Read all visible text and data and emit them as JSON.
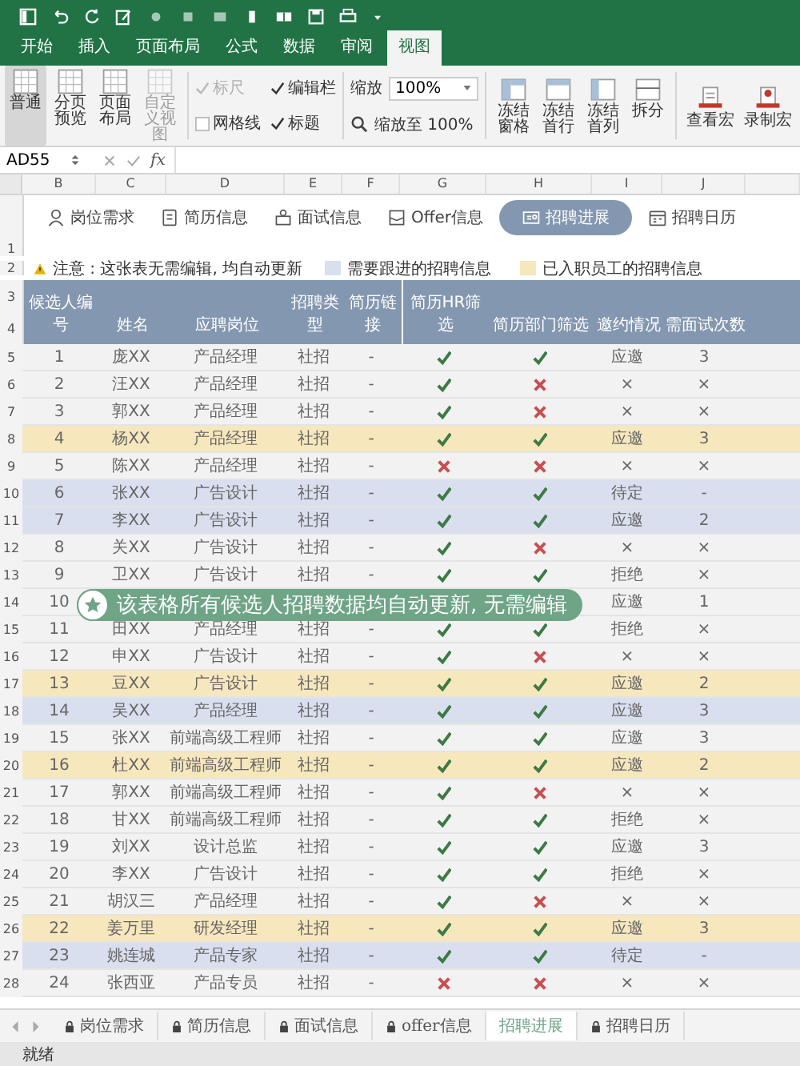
{
  "ribbon_tabs": [
    {
      "label": "开始",
      "selected": false
    },
    {
      "label": "插入",
      "selected": false
    },
    {
      "label": "页面布局",
      "selected": false
    },
    {
      "label": "公式",
      "selected": false
    },
    {
      "label": "数据",
      "selected": false
    },
    {
      "label": "审阅",
      "selected": false
    },
    {
      "label": "视图",
      "selected": true
    }
  ],
  "view_buttons": [
    {
      "label": "普通",
      "selected": true,
      "disabled": false
    },
    {
      "label": "分页预览",
      "selected": false,
      "disabled": false
    },
    {
      "label": "页面布局",
      "selected": false,
      "disabled": false
    },
    {
      "label": "自定义视图",
      "selected": false,
      "disabled": true
    }
  ],
  "show_options": [
    {
      "label": "标尺",
      "checked": true,
      "disabled": true
    },
    {
      "label": "编辑栏",
      "checked": true,
      "disabled": false
    },
    {
      "label": "网格线",
      "checked": false,
      "disabled": false
    },
    {
      "label": "标题",
      "checked": true,
      "disabled": false
    }
  ],
  "zoom": {
    "label": "缩放",
    "value": "100%",
    "zoom_to": "缩放至 100%"
  },
  "window_buttons": [
    {
      "label": "冻结窗格",
      "kind": "freeze"
    },
    {
      "label": "冻结首行",
      "kind": "freeze-row"
    },
    {
      "label": "冻结首列",
      "kind": "freeze-col"
    },
    {
      "label": "拆分",
      "kind": "split"
    }
  ],
  "macro_buttons": [
    {
      "label": "查看宏",
      "kind": "view"
    },
    {
      "label": "录制宏",
      "kind": "record"
    }
  ],
  "formula_bar": {
    "cell": "AD55",
    "fx": "fx"
  },
  "column_letters": [
    "B",
    "C",
    "D",
    "E",
    "F",
    "G",
    "H",
    "I",
    "J"
  ],
  "nav_buttons": [
    {
      "label": "岗位需求",
      "kind": "person",
      "selected": false
    },
    {
      "label": "简历信息",
      "kind": "doc",
      "selected": false
    },
    {
      "label": "面试信息",
      "kind": "people",
      "selected": false
    },
    {
      "label": "Offer信息",
      "kind": "mail",
      "selected": false
    },
    {
      "label": "招聘进展",
      "kind": "card",
      "selected": true
    },
    {
      "label": "招聘日历",
      "kind": "calendar",
      "selected": false
    }
  ],
  "header_row_numbers": [
    "1",
    "2",
    "3",
    "4"
  ],
  "notice": "注意 : 这张表无需编辑, 均自动更新",
  "legend": [
    {
      "label": "需要跟进的招聘信息",
      "color": "#d9dfee"
    },
    {
      "label": "已入职员工的招聘信息",
      "color": "#f7e7bd"
    }
  ],
  "columns": [
    "候选人编号",
    "姓名",
    "应聘岗位",
    "招聘类型",
    "简历链接",
    "简历HR筛选",
    "简历部门筛选",
    "邀约情况",
    "需面试次数"
  ],
  "rows": [
    {
      "row_number": "5",
      "id": "1",
      "name": "庞XX",
      "position": "产品经理",
      "type": "社招",
      "link": "-",
      "hr_pass": true,
      "dept_pass": true,
      "invite": "应邀",
      "interviews": "3",
      "color": "#f2f2f2"
    },
    {
      "row_number": "6",
      "id": "2",
      "name": "汪XX",
      "position": "产品经理",
      "type": "社招",
      "link": "-",
      "hr_pass": true,
      "dept_pass": false,
      "invite": "×",
      "interviews": "×",
      "color": "#f2f2f2"
    },
    {
      "row_number": "7",
      "id": "3",
      "name": "郭XX",
      "position": "产品经理",
      "type": "社招",
      "link": "-",
      "hr_pass": true,
      "dept_pass": false,
      "invite": "×",
      "interviews": "×",
      "color": "#f2f2f2"
    },
    {
      "row_number": "8",
      "id": "4",
      "name": "杨XX",
      "position": "产品经理",
      "type": "社招",
      "link": "-",
      "hr_pass": true,
      "dept_pass": true,
      "invite": "应邀",
      "interviews": "3",
      "color": "#f7e7bd"
    },
    {
      "row_number": "9",
      "id": "5",
      "name": "陈XX",
      "position": "产品经理",
      "type": "社招",
      "link": "-",
      "hr_pass": false,
      "dept_pass": false,
      "invite": "×",
      "interviews": "×",
      "color": "#f2f2f2"
    },
    {
      "row_number": "10",
      "id": "6",
      "name": "张XX",
      "position": "广告设计",
      "type": "社招",
      "link": "-",
      "hr_pass": true,
      "dept_pass": true,
      "invite": "待定",
      "interviews": "-",
      "color": "#d9dfee"
    },
    {
      "row_number": "11",
      "id": "7",
      "name": "李XX",
      "position": "广告设计",
      "type": "社招",
      "link": "-",
      "hr_pass": true,
      "dept_pass": true,
      "invite": "应邀",
      "interviews": "2",
      "color": "#d9dfee"
    },
    {
      "row_number": "12",
      "id": "8",
      "name": "关XX",
      "position": "广告设计",
      "type": "社招",
      "link": "-",
      "hr_pass": true,
      "dept_pass": false,
      "invite": "×",
      "interviews": "×",
      "color": "#f2f2f2"
    },
    {
      "row_number": "13",
      "id": "9",
      "name": "卫XX",
      "position": "广告设计",
      "type": "社招",
      "link": "-",
      "hr_pass": true,
      "dept_pass": true,
      "invite": "拒绝",
      "interviews": "×",
      "color": "#f2f2f2"
    },
    {
      "row_number": "14",
      "id": "10",
      "invite": "应邀",
      "interviews": "1",
      "color": "#f2f2f2"
    },
    {
      "row_number": "15",
      "id": "11",
      "name": "田XX",
      "position": "产品经理",
      "type": "社招",
      "link": "-",
      "hr_pass": true,
      "dept_pass": true,
      "invite": "拒绝",
      "interviews": "×",
      "color": "#f2f2f2"
    },
    {
      "row_number": "16",
      "id": "12",
      "name": "申XX",
      "position": "广告设计",
      "type": "社招",
      "link": "-",
      "hr_pass": true,
      "dept_pass": false,
      "invite": "×",
      "interviews": "×",
      "color": "#f2f2f2"
    },
    {
      "row_number": "17",
      "id": "13",
      "name": "豆XX",
      "position": "广告设计",
      "type": "社招",
      "link": "-",
      "hr_pass": true,
      "dept_pass": true,
      "invite": "应邀",
      "interviews": "2",
      "color": "#f7e7bd"
    },
    {
      "row_number": "18",
      "id": "14",
      "name": "吴XX",
      "position": "产品经理",
      "type": "社招",
      "link": "-",
      "hr_pass": true,
      "dept_pass": true,
      "invite": "应邀",
      "interviews": "3",
      "color": "#d9dfee"
    },
    {
      "row_number": "19",
      "id": "15",
      "name": "张XX",
      "position": "前端高级工程师",
      "type": "社招",
      "link": "-",
      "hr_pass": true,
      "dept_pass": true,
      "invite": "应邀",
      "interviews": "3",
      "color": "#f2f2f2"
    },
    {
      "row_number": "20",
      "id": "16",
      "name": "杜XX",
      "position": "前端高级工程师",
      "type": "社招",
      "link": "-",
      "hr_pass": true,
      "dept_pass": true,
      "invite": "应邀",
      "interviews": "2",
      "color": "#f7e7bd"
    },
    {
      "row_number": "21",
      "id": "17",
      "name": "郭XX",
      "position": "前端高级工程师",
      "type": "社招",
      "link": "-",
      "hr_pass": true,
      "dept_pass": false,
      "invite": "×",
      "interviews": "×",
      "color": "#f2f2f2"
    },
    {
      "row_number": "22",
      "id": "18",
      "name": "甘XX",
      "position": "前端高级工程师",
      "type": "社招",
      "link": "-",
      "hr_pass": true,
      "dept_pass": true,
      "invite": "拒绝",
      "interviews": "×",
      "color": "#f2f2f2"
    },
    {
      "row_number": "23",
      "id": "19",
      "name": "刘XX",
      "position": "设计总监",
      "type": "社招",
      "link": "-",
      "hr_pass": true,
      "dept_pass": true,
      "invite": "应邀",
      "interviews": "3",
      "color": "#f2f2f2"
    },
    {
      "row_number": "24",
      "id": "20",
      "name": "李XX",
      "position": "广告设计",
      "type": "社招",
      "link": "-",
      "hr_pass": true,
      "dept_pass": true,
      "invite": "拒绝",
      "interviews": "×",
      "color": "#f2f2f2"
    },
    {
      "row_number": "25",
      "id": "21",
      "name": "胡汉三",
      "position": "产品经理",
      "type": "社招",
      "link": "-",
      "hr_pass": true,
      "dept_pass": false,
      "invite": "×",
      "interviews": "×",
      "color": "#f2f2f2"
    },
    {
      "row_number": "26",
      "id": "22",
      "name": "姜万里",
      "position": "研发经理",
      "type": "社招",
      "link": "-",
      "hr_pass": true,
      "dept_pass": true,
      "invite": "应邀",
      "interviews": "3",
      "color": "#f7e7bd"
    },
    {
      "row_number": "27",
      "id": "23",
      "name": "姚连城",
      "position": "产品专家",
      "type": "社招",
      "link": "-",
      "hr_pass": true,
      "dept_pass": true,
      "invite": "待定",
      "interviews": "-",
      "color": "#d9dfee"
    },
    {
      "row_number": "28",
      "id": "24",
      "name": "张西亚",
      "position": "产品专员",
      "type": "社招",
      "link": "-",
      "hr_pass": false,
      "dept_pass": false,
      "invite": "×",
      "interviews": "×",
      "color": "#f2f2f2"
    }
  ],
  "banner": "该表格所有候选人招聘数据均自动更新, 无需编辑",
  "sheet_tabs": [
    {
      "label": "岗位需求",
      "locked": true,
      "selected": false
    },
    {
      "label": "简历信息",
      "locked": true,
      "selected": false
    },
    {
      "label": "面试信息",
      "locked": true,
      "selected": false
    },
    {
      "label": "offer信息",
      "locked": true,
      "selected": false
    },
    {
      "label": "招聘进展",
      "locked": false,
      "selected": true
    },
    {
      "label": "招聘日历",
      "locked": true,
      "selected": false
    }
  ],
  "status_bar": "就绪"
}
